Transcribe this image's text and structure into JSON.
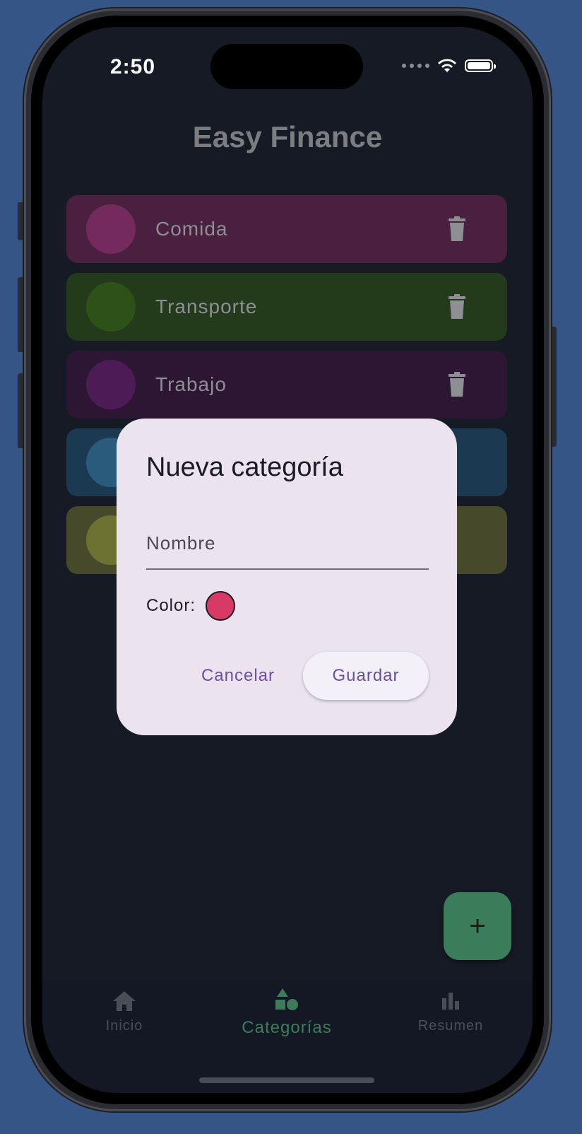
{
  "status_bar": {
    "time": "2:50"
  },
  "app": {
    "title": "Easy Finance"
  },
  "categories": [
    {
      "label": "Comida",
      "bg": "#4a1f3f",
      "circle": "#752a5e"
    },
    {
      "label": "Transporte",
      "bg": "#233a1b",
      "circle": "#2d5217"
    },
    {
      "label": "Trabajo",
      "bg": "#2d1634",
      "circle": "#4d1c57"
    },
    {
      "label": "",
      "bg": "#1b3a52",
      "circle": "#2a5b7d"
    },
    {
      "label": "",
      "bg": "#464a2a",
      "circle": "#6d7131"
    }
  ],
  "dialog": {
    "title": "Nueva categoría",
    "name_placeholder": "Nombre",
    "color_label": "Color:",
    "selected_color": "#d83a66",
    "cancel_label": "Cancelar",
    "save_label": "Guardar"
  },
  "fab": {
    "label": "+"
  },
  "nav": {
    "items": [
      {
        "label": "Inicio",
        "icon": "home-icon",
        "active": false
      },
      {
        "label": "Categorías",
        "icon": "category-icon",
        "active": true
      },
      {
        "label": "Resumen",
        "icon": "bar-chart-icon",
        "active": false
      }
    ]
  },
  "colors": {
    "accent": "#3b7d5b",
    "dialog_bg": "#ebe4ef",
    "button_text": "#6a4fa5"
  }
}
